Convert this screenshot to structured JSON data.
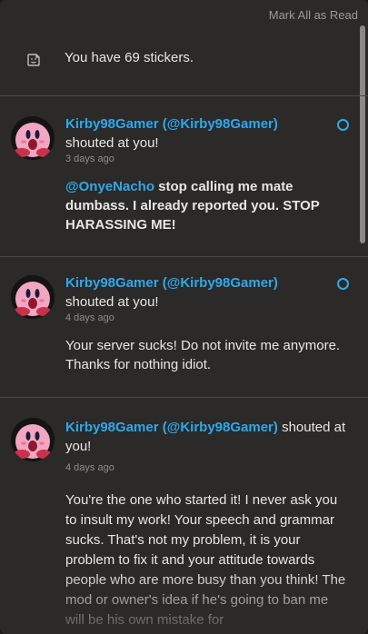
{
  "header": {
    "mark_all_label": "Mark All as Read"
  },
  "stickers": {
    "icon": "sticker-icon",
    "text": "You have 69 stickers."
  },
  "notifications": [
    {
      "user": "Kirby98Gamer (@Kirby98Gamer)",
      "action": "shouted at you!",
      "time": "3 days ago",
      "mention": "@OnyeNacho",
      "message": " stop calling me mate dumbass. I already reported you. STOP HARASSING ME!",
      "unread": true
    },
    {
      "user": "Kirby98Gamer (@Kirby98Gamer)",
      "action": "shouted at you!",
      "time": "4 days ago",
      "message": "Your server sucks! Do not invite me anymore. Thanks for nothing idiot.",
      "unread": true
    },
    {
      "user": "Kirby98Gamer (@Kirby98Gamer)",
      "action": "shouted at you!",
      "time": "4 days ago",
      "message": "You're the one who started it! I never ask you to insult my work! Your speech and grammar sucks. That's not my problem, it is your problem to fix it and your attitude towards people who are more busy than you think! The mod or owner's idea if he's going to ban me will be his own mistake for"
    }
  ],
  "colors": {
    "accent": "#2ea8ec",
    "panel": "#2b2a28",
    "divider": "#4b4946"
  }
}
